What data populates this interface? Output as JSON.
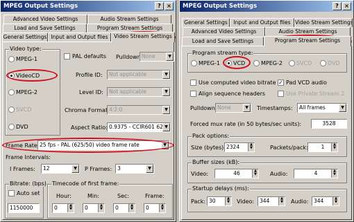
{
  "left": {
    "title": "MPEG Output Settings",
    "tabs_row1": [
      "Advanced Video Settings",
      "Audio Stream Settings"
    ],
    "tabs_row2": [
      "Load and Save Settings",
      "Program Stream Settings"
    ],
    "tabs_row3": [
      "General Settings",
      "Input and Output files",
      "Video Stream Settings"
    ],
    "video_type_label": "Video type:",
    "video_types": [
      "MPEG-1",
      "VideoCD",
      "MPEG-2",
      "SVCD",
      "DVD"
    ],
    "pal_defaults": "PAL defaults",
    "pulldown_label": "Pulldown:",
    "pulldown_value": "None",
    "profile_label": "Profile ID:",
    "profile_value": "Not applicable",
    "level_label": "Level ID:",
    "level_value": "Not applicable",
    "chroma_label": "Chroma Format:",
    "chroma_value": "4:2:0",
    "aspect_label": "Aspect Ratio:",
    "aspect_value": "0.9375 - CCIR601 62",
    "frame_rate_label": "Frame Rate:",
    "frame_rate_value": "25 fps - PAL (625/50) video frame rate",
    "frame_intervals_label": "Frame Intervals:",
    "i_frames_label": "I Frames:",
    "i_frames_value": "12",
    "p_frames_label": "P Frames:",
    "p_frames_value": "3",
    "bitrate_label": "Bitrate: (bps)",
    "auto_set": "Auto set",
    "bitrate_value": "1150000",
    "timecode_label": "Timecode of first frame:",
    "tc_headers": [
      "Hour:",
      "Min:",
      "Sec:",
      "Frame:"
    ],
    "tc_values": [
      "0",
      "0",
      "0",
      "0"
    ]
  },
  "right": {
    "title": "MPEG Output Settings",
    "tabs_row1": [
      "General Settings",
      "Input and Output files",
      "Video Stream Settings"
    ],
    "tabs_row2": [
      "Advanced Video Settings",
      "Audio Stream Settings"
    ],
    "tabs_row3": [
      "Load and Save Settings",
      "Program Stream Settings"
    ],
    "ps_type_label": "Program stream type:",
    "ps_types": [
      "MPEG-1",
      "VCD",
      "MPEG-2",
      "SVCD",
      "DVD"
    ],
    "use_computed": "Use computed video bitrate",
    "pad_vcd": "Pad VCD audio",
    "align_headers": "Align sequence headers",
    "use_private": "Use Private Stream 2",
    "pulldown_label": "Pulldown:",
    "pulldown_value": "None",
    "timestamps_label": "Timestamps:",
    "timestamps_value": "All frames",
    "forced_mux_label": "Forced mux rate (in 50 bytes/sec units):",
    "forced_mux_value": "3528",
    "pack_options_label": "Pack options:",
    "size_label": "Size (bytes):",
    "size_value": "2324",
    "packets_label": "Packets/pack:",
    "packets_value": "1",
    "buffer_label": "Buffer sizes (kB):",
    "video_label": "Video:",
    "video_value": "46",
    "audio_label": "Audio:",
    "audio_value": "4",
    "startup_label": "Startup delays (ms):",
    "pack_label": "Pack:",
    "pack_value": "30",
    "sd_video_label": "Video:",
    "sd_video_value": "344",
    "sd_audio_label": "Audio:",
    "sd_audio_value": "344"
  },
  "buttons": {
    "help": "?",
    "close": "×"
  },
  "colors": {
    "title_bar": "#0a246a",
    "face": "#d4d0c8",
    "annotation": "#d01020"
  }
}
